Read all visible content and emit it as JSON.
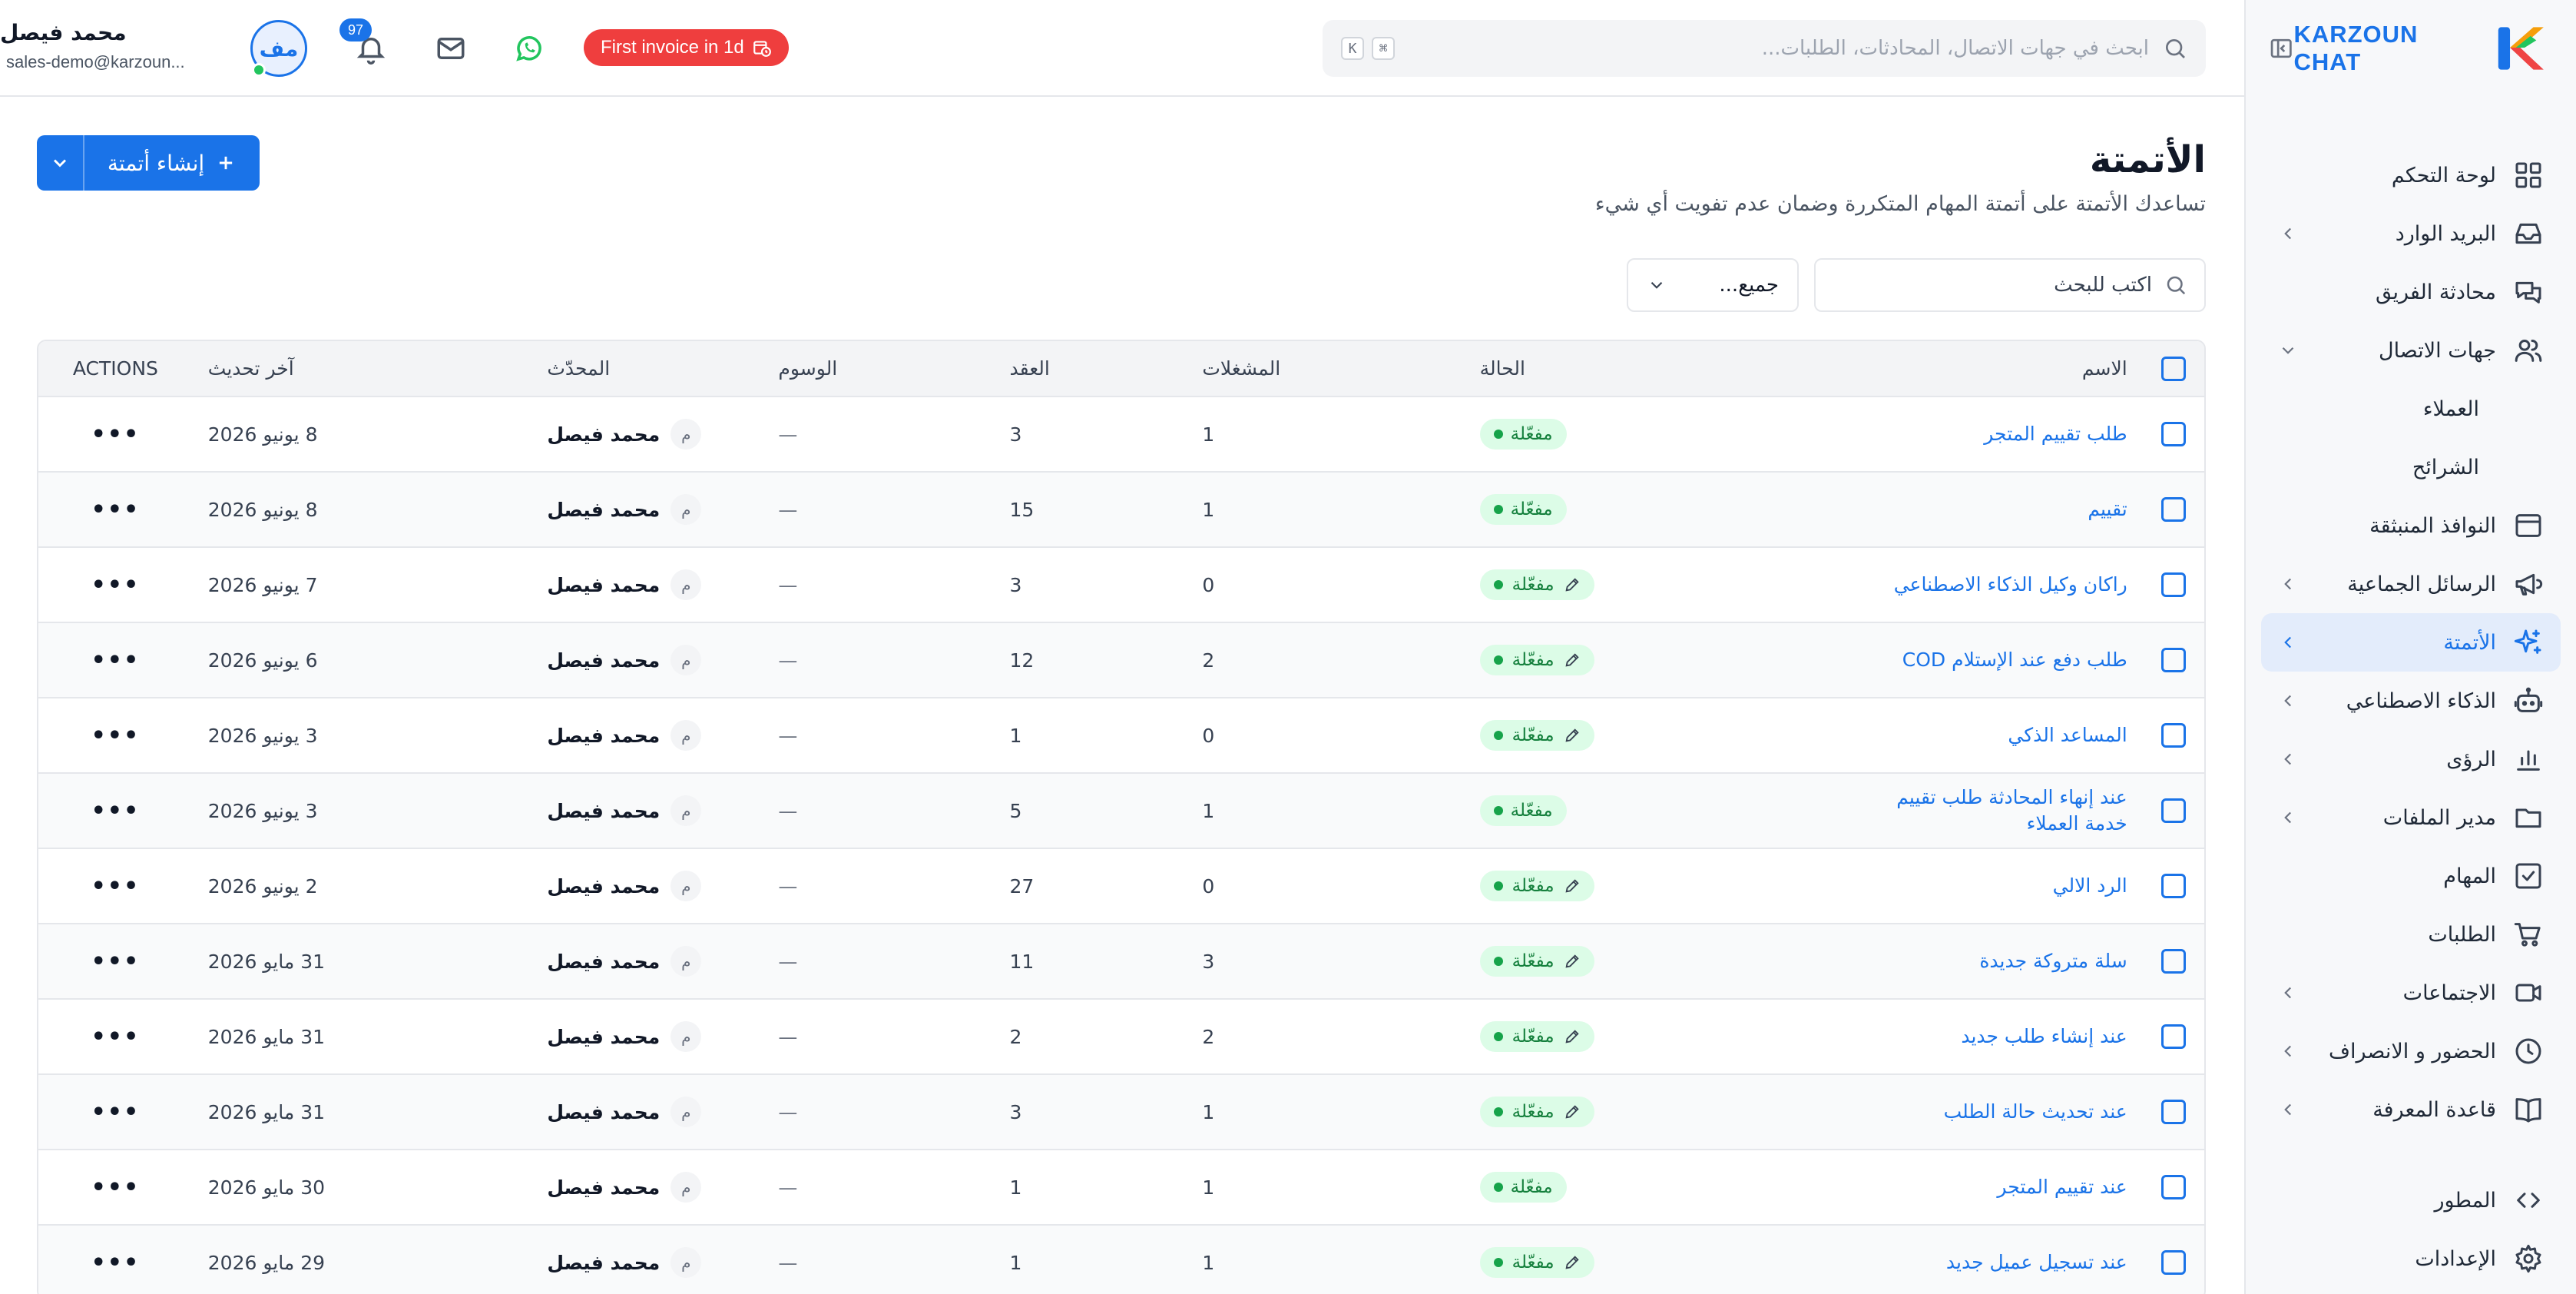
{
  "brand": {
    "name": "KARZOUN CHAT"
  },
  "header": {
    "search_placeholder": "ابحث في جهات الاتصال، المحادثات، الطلبات...",
    "kbd_1": "K",
    "kbd_2": "⌘",
    "invoice_badge": "First invoice in 1d",
    "notifications_count": "97",
    "user": {
      "initials": "مف",
      "name": "محمد فيصل",
      "email": "sales-demo@karzoun..."
    }
  },
  "sidebar": {
    "items": [
      {
        "label": "لوحة التحكم",
        "icon": "dashboard-icon",
        "chevron": false
      },
      {
        "label": "البريد الوارد",
        "icon": "inbox-icon",
        "chevron": true
      },
      {
        "label": "محادثة الفريق",
        "icon": "chat-icon",
        "chevron": false
      },
      {
        "label": "جهات الاتصال",
        "icon": "users-icon",
        "chevron": true,
        "expanded": true
      },
      {
        "label": "العملاء",
        "sub": true
      },
      {
        "label": "الشرائح",
        "sub": true
      },
      {
        "label": "النوافذ المنبثقة",
        "icon": "popup-icon",
        "chevron": false
      },
      {
        "label": "الرسائل الجماعية",
        "icon": "megaphone-icon",
        "chevron": true
      },
      {
        "label": "الأتمتة",
        "icon": "sparkle-icon",
        "chevron": true,
        "active": true
      },
      {
        "label": "الذكاء الاصطناعي",
        "icon": "bot-icon",
        "chevron": true
      },
      {
        "label": "الرؤى",
        "icon": "chart-icon",
        "chevron": true
      },
      {
        "label": "مدير الملفات",
        "icon": "folder-icon",
        "chevron": true
      },
      {
        "label": "المهام",
        "icon": "task-icon",
        "chevron": false
      },
      {
        "label": "الطلبات",
        "icon": "cart-icon",
        "chevron": false
      },
      {
        "label": "الاجتماعات",
        "icon": "video-icon",
        "chevron": true
      },
      {
        "label": "الحضور و الانصراف",
        "icon": "clock-icon",
        "chevron": true
      },
      {
        "label": "قاعدة المعرفة",
        "icon": "book-icon",
        "chevron": true
      }
    ],
    "bottom": [
      {
        "label": "المطور",
        "icon": "code-icon"
      },
      {
        "label": "الإعدادات",
        "icon": "gear-icon"
      }
    ]
  },
  "page": {
    "title": "الأتمتة",
    "subtitle": "تساعدك الأتمتة على أتمتة المهام المتكررة وضمان عدم تفويت أي شيء",
    "create_button": "إنشاء أتمتة",
    "filter_search_placeholder": "اكتب للبحث",
    "filter_select_value": "جميع..."
  },
  "table": {
    "headers": {
      "name": "الاسم",
      "status": "الحالة",
      "triggers": "المشغلات",
      "nodes": "العقد",
      "tags": "الوسوم",
      "updated_by": "المحدّث",
      "last_updated": "آخر تحديث",
      "actions": "ACTIONS"
    },
    "rows": [
      {
        "name": "طلب تقييم المتجر",
        "status": "مفعّلة",
        "draft": false,
        "triggers": "1",
        "nodes": "3",
        "tags": "—",
        "updater_initial": "م",
        "updater": "محمد فيصل",
        "date": "8 يونيو 2026"
      },
      {
        "name": "تقييم",
        "status": "مفعّلة",
        "draft": false,
        "triggers": "1",
        "nodes": "15",
        "tags": "—",
        "updater_initial": "م",
        "updater": "محمد فيصل",
        "date": "8 يونيو 2026"
      },
      {
        "name": "راكان وكيل الذكاء الاصطناعي",
        "status": "مفعّلة",
        "draft": true,
        "triggers": "0",
        "nodes": "3",
        "tags": "—",
        "updater_initial": "م",
        "updater": "محمد فيصل",
        "date": "7 يونيو 2026"
      },
      {
        "name": "طلب دفع عند الإستلام COD",
        "status": "مفعّلة",
        "draft": true,
        "triggers": "2",
        "nodes": "12",
        "tags": "—",
        "updater_initial": "م",
        "updater": "محمد فيصل",
        "date": "6 يونيو 2026"
      },
      {
        "name": "المساعد الذكي",
        "status": "مفعّلة",
        "draft": true,
        "triggers": "0",
        "nodes": "1",
        "tags": "—",
        "updater_initial": "م",
        "updater": "محمد فيصل",
        "date": "3 يونيو 2026"
      },
      {
        "name": "عند إنهاء المحادثة طلب تقييم خدمة العملاء",
        "status": "مفعّلة",
        "draft": false,
        "triggers": "1",
        "nodes": "5",
        "tags": "—",
        "updater_initial": "م",
        "updater": "محمد فيصل",
        "date": "3 يونيو 2026"
      },
      {
        "name": "الرد الالي",
        "status": "مفعّلة",
        "draft": true,
        "triggers": "0",
        "nodes": "27",
        "tags": "—",
        "updater_initial": "م",
        "updater": "محمد فيصل",
        "date": "2 يونيو 2026"
      },
      {
        "name": "سلة متروكة جديدة",
        "status": "مفعّلة",
        "draft": true,
        "triggers": "3",
        "nodes": "11",
        "tags": "—",
        "updater_initial": "م",
        "updater": "محمد فيصل",
        "date": "31 مايو 2026"
      },
      {
        "name": "عند إنشاء طلب جديد",
        "status": "مفعّلة",
        "draft": true,
        "triggers": "2",
        "nodes": "2",
        "tags": "—",
        "updater_initial": "م",
        "updater": "محمد فيصل",
        "date": "31 مايو 2026"
      },
      {
        "name": "عند تحديث حالة الطلب",
        "status": "مفعّلة",
        "draft": true,
        "triggers": "1",
        "nodes": "3",
        "tags": "—",
        "updater_initial": "م",
        "updater": "محمد فيصل",
        "date": "31 مايو 2026"
      },
      {
        "name": "عند تقييم المتجر",
        "status": "مفعّلة",
        "draft": false,
        "triggers": "1",
        "nodes": "1",
        "tags": "—",
        "updater_initial": "م",
        "updater": "محمد فيصل",
        "date": "30 مايو 2026"
      },
      {
        "name": "عند تسجيل عميل جديد",
        "status": "مفعّلة",
        "draft": true,
        "triggers": "1",
        "nodes": "1",
        "tags": "—",
        "updater_initial": "م",
        "updater": "محمد فيصل",
        "date": "29 مايو 2026"
      }
    ]
  },
  "colors": {
    "accent": "#1a73e8",
    "active_bg": "#e3ecfb",
    "badge_red": "#ef3e3e",
    "status_green_bg": "#dcfce7",
    "status_green_text": "#15803d",
    "whatsapp": "#22c55e"
  }
}
